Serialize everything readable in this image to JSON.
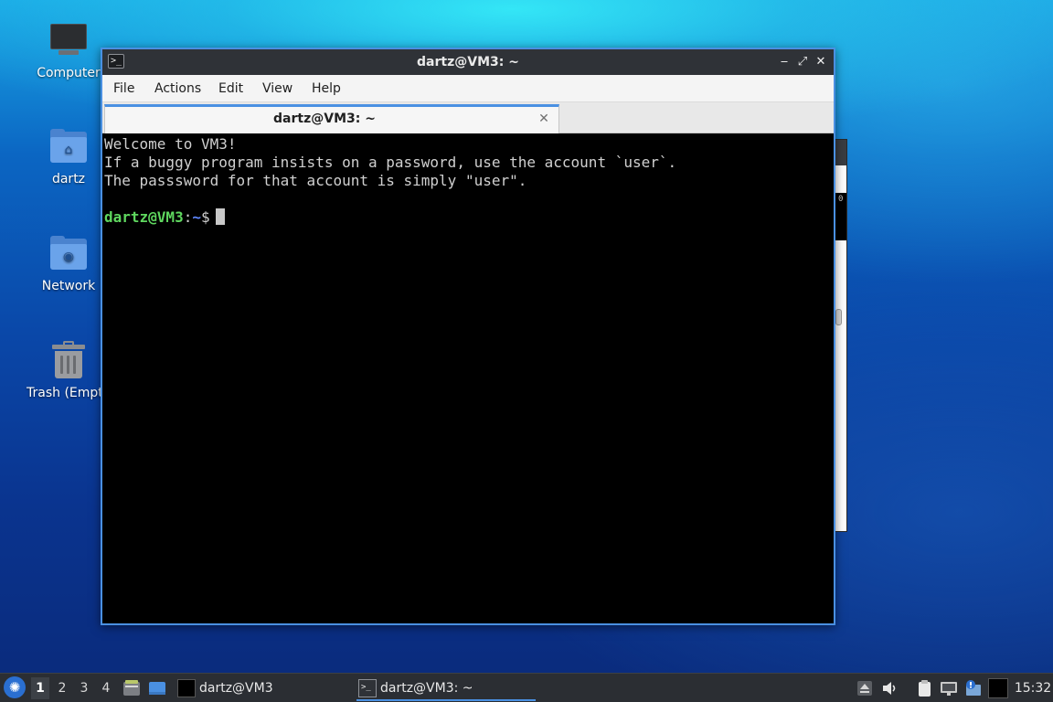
{
  "desktop": {
    "icons": [
      {
        "label": "Computer"
      },
      {
        "label": "dartz"
      },
      {
        "label": "Network"
      },
      {
        "label": "Trash (Empty)"
      }
    ]
  },
  "behind_window": {
    "fragment_text": "0"
  },
  "terminal_window": {
    "title": "dartz@VM3: ~",
    "controls": {
      "minimize": "‒",
      "maximize": "⤢",
      "close": "✕"
    },
    "menu": [
      "File",
      "Actions",
      "Edit",
      "View",
      "Help"
    ],
    "tab": {
      "label": "dartz@VM3: ~",
      "close_glyph": "✕"
    },
    "output_lines": [
      "Welcome to VM3!",
      "If a buggy program insists on a password, use the account `user`.",
      "The passsword for that account is simply \"user\"."
    ],
    "prompt": {
      "user_host": "dartz@VM3",
      "separator": ":",
      "path": "~",
      "symbol": "$"
    }
  },
  "taskbar": {
    "workspaces": [
      "1",
      "2",
      "3",
      "4"
    ],
    "active_workspace": "1",
    "tasks": [
      {
        "label": "dartz@VM3"
      },
      {
        "label": "dartz@VM3: ~"
      }
    ],
    "clock": "15:32",
    "accent_color": "#4a90e2"
  }
}
